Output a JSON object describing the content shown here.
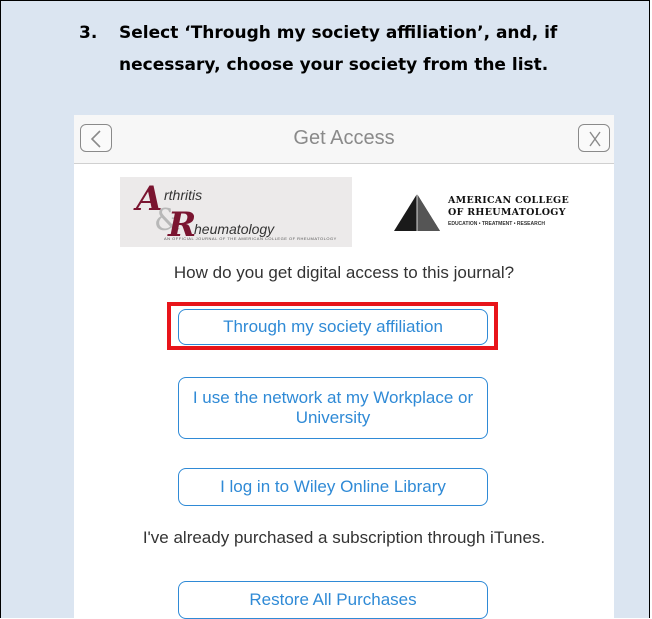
{
  "instruction": {
    "number": "3.",
    "line1": "Select ‘Through my society affiliation’, and, if",
    "line2": "necessary, choose your society from the list."
  },
  "nav": {
    "title": "Get Access",
    "back_icon": "chevron-left-icon",
    "close_icon": "close-x-icon"
  },
  "logos": {
    "journal": {
      "letter_a": "A",
      "word_a": "rthritis",
      "amp": "&",
      "letter_r": "R",
      "word_r": "heumatology",
      "tagline": "AN OFFICIAL JOURNAL OF THE AMERICAN COLLEGE OF RHEUMATOLOGY"
    },
    "college": {
      "line1": "AMERICAN COLLEGE",
      "line2": "OF RHEUMATOLOGY",
      "line3": "EDUCATION • TREATMENT • RESEARCH"
    }
  },
  "question": "How do you get digital access to this journal?",
  "buttons": {
    "society": "Through my society affiliation",
    "network": "I use the network at my Workplace or University",
    "wiley": "I log in to Wiley Online Library",
    "restore": "Restore All Purchases"
  },
  "itunes_text": "I've already purchased a subscription through iTunes.",
  "colors": {
    "accent": "#2f8ad6",
    "highlight": "#e8141a",
    "journal_brand": "#7a1530",
    "panel_background": "#dbe5f1"
  }
}
